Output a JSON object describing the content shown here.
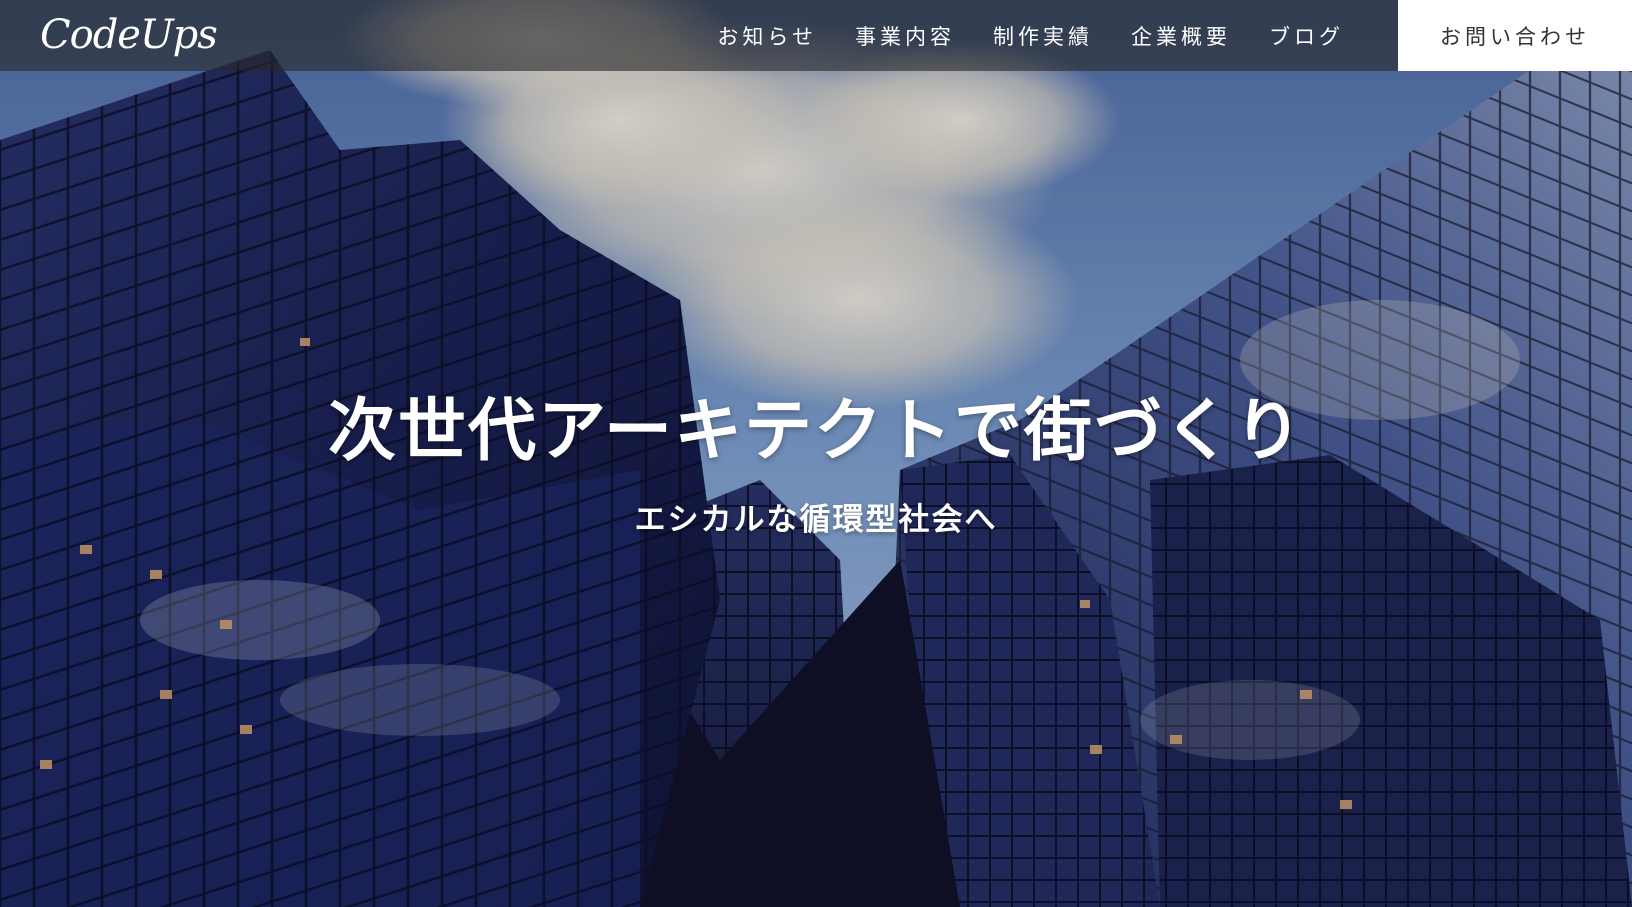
{
  "site": {
    "logo": "CodeUps"
  },
  "nav": {
    "items": [
      {
        "label": "お知らせ"
      },
      {
        "label": "事業内容"
      },
      {
        "label": "制作実績"
      },
      {
        "label": "企業概要"
      },
      {
        "label": "ブログ"
      }
    ],
    "contact_label": "お問い合わせ"
  },
  "hero": {
    "title": "次世代アーキテクトで街づくり",
    "subtitle": "エシカルな循環型社会へ",
    "image_subject": "glass-skyscrapers-looking-up-icon"
  },
  "colors": {
    "header_bg": "#282828",
    "contact_bg": "#ffffff",
    "text_light": "#ffffff",
    "text_dark": "#333333",
    "sky": "#6e8fc4",
    "glass_dark": "#1b2147"
  }
}
